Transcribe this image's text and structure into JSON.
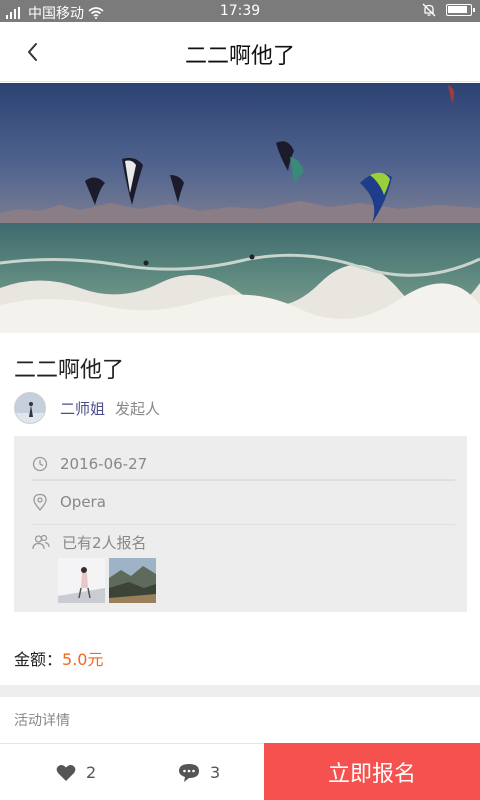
{
  "status_bar": {
    "carrier": "中国移动",
    "time": "17:39",
    "battery_level": 0.9,
    "signal_icon": "signal-icon",
    "wifi_icon": "wifi-icon",
    "mute_icon": "bell-off-icon"
  },
  "nav": {
    "back_icon": "chevron-left-icon",
    "title": "二二啊他了"
  },
  "event": {
    "title": "二二啊他了",
    "organizer_name": "二师姐",
    "organizer_role": "发起人",
    "date": "2016-06-27",
    "location": "Opera",
    "signup_text": "已有2人报名"
  },
  "price": {
    "label": "金额：",
    "value": "5.0元"
  },
  "section": {
    "details_label": "活动详情"
  },
  "bottom": {
    "like_count": "2",
    "comment_count": "3",
    "signup_label": "立即报名"
  },
  "colors": {
    "accent": "#f5524f",
    "price": "#f06a21",
    "organizer": "#4a4e8a",
    "statusbar": "#7b7b7b"
  }
}
